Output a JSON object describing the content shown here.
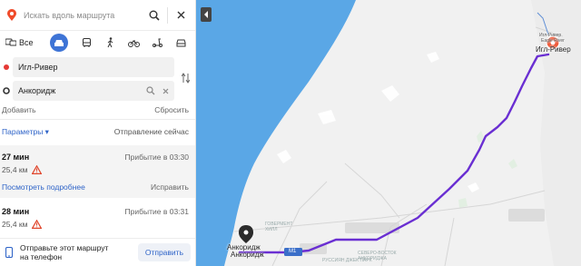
{
  "search": {
    "placeholder": "Искать вдоль маршрута"
  },
  "modes": {
    "all_label": "Все"
  },
  "waypoints": {
    "from": "Игл-Ривер",
    "to": "Анкоридж"
  },
  "actions": {
    "add": "Добавить",
    "reset": "Сбросить"
  },
  "params": {
    "label": "Параметры ▾",
    "departure": "Отправление сейчас"
  },
  "routes": [
    {
      "time": "27 мин",
      "arrival": "Прибытие в 03:30",
      "distance": "25,4 км",
      "more": "Посмотреть подробнее",
      "fix": "Исправить"
    },
    {
      "time": "28 мин",
      "arrival": "Прибытие в 03:31",
      "distance": "25,4 км"
    }
  ],
  "send": {
    "text_line1": "Отправьте этот маршрут",
    "text_line2": "на телефон",
    "button": "Отправить"
  },
  "map": {
    "start_label_top": "Игл-Ривер",
    "start_label_en": "Eagle River",
    "start_label_main": "Игл-Ривер",
    "end_label_top": "Анкоридж",
    "end_label_main": "Анкоридж",
    "district1": "ГОВЕРМЕНТ ХИЛЛ",
    "district2": "СЕВЕРО-ВОСТОК АНКОРИДЖА",
    "district3": "РУССИЯН ДЖЕК ПАРК",
    "highway_badge": "M1",
    "route_color": "#6a2fd2",
    "water_color": "#5aa7e6"
  }
}
